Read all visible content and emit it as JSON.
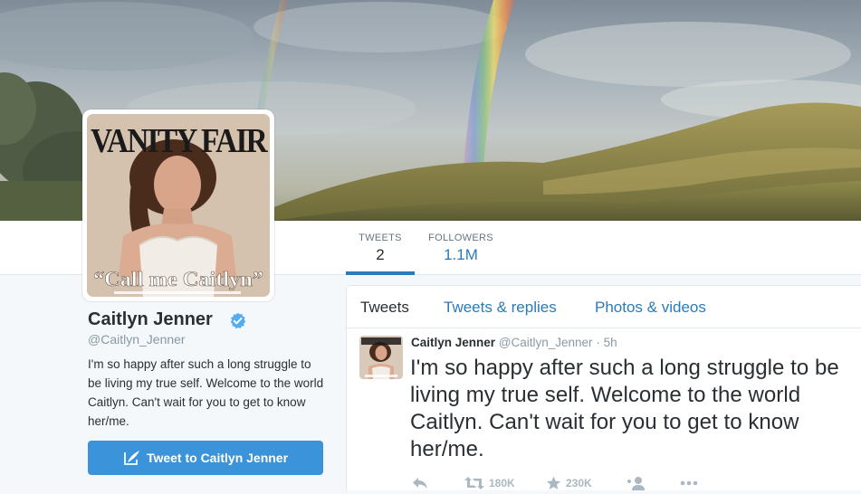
{
  "profile": {
    "name": "Caitlyn Jenner",
    "handle": "@Caitlyn_Jenner",
    "bio": "I'm so happy after such a long struggle to be living my true self. Welcome to the world Caitlyn. Can't wait for you to get to know her/me.",
    "verified": true,
    "tweet_to_label": "Tweet to Caitlyn Jenner",
    "avatar": {
      "magazine_title": "VANITY FAIR",
      "cover_line": "“Call me Caitlyn”"
    }
  },
  "nav": {
    "stats": [
      {
        "label": "TWEETS",
        "value": "2",
        "active": true
      },
      {
        "label": "FOLLOWERS",
        "value": "1.1M",
        "active": false
      }
    ]
  },
  "timeline": {
    "tabs": [
      {
        "label": "Tweets",
        "active": true
      },
      {
        "label": "Tweets & replies",
        "active": false
      },
      {
        "label": "Photos & videos",
        "active": false
      }
    ],
    "tweets": [
      {
        "name": "Caitlyn Jenner",
        "handle": "@Caitlyn_Jenner",
        "separator": "·",
        "time": "5h",
        "text": "I'm so happy after such a long struggle to be living my true self. Welcome to the world Caitlyn. Can't wait for you to get to know her/me.",
        "retweets": "180K",
        "favorites": "230K"
      }
    ]
  },
  "colors": {
    "link_blue": "#2b7bb9",
    "button_blue": "#3b94d9",
    "verified_blue": "#55acee",
    "muted_text": "#8899a6",
    "action_gray": "#aab8c2",
    "page_background": "#f5f8fa"
  },
  "icons": {
    "verified": "verified-badge-icon",
    "tweet_button": "compose-quill-icon",
    "reply": "reply-icon",
    "retweet": "retweet-icon",
    "favorite": "star-icon",
    "follow": "add-user-icon",
    "more": "more-dots-icon"
  }
}
